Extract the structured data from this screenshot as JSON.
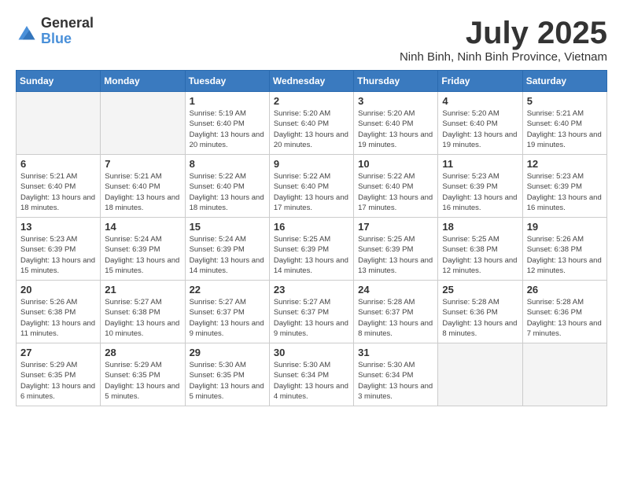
{
  "logo": {
    "general": "General",
    "blue": "Blue"
  },
  "title": "July 2025",
  "location": "Ninh Binh, Ninh Binh Province, Vietnam",
  "days_of_week": [
    "Sunday",
    "Monday",
    "Tuesday",
    "Wednesday",
    "Thursday",
    "Friday",
    "Saturday"
  ],
  "weeks": [
    [
      {
        "day": "",
        "info": ""
      },
      {
        "day": "",
        "info": ""
      },
      {
        "day": "1",
        "info": "Sunrise: 5:19 AM\nSunset: 6:40 PM\nDaylight: 13 hours and 20 minutes."
      },
      {
        "day": "2",
        "info": "Sunrise: 5:20 AM\nSunset: 6:40 PM\nDaylight: 13 hours and 20 minutes."
      },
      {
        "day": "3",
        "info": "Sunrise: 5:20 AM\nSunset: 6:40 PM\nDaylight: 13 hours and 19 minutes."
      },
      {
        "day": "4",
        "info": "Sunrise: 5:20 AM\nSunset: 6:40 PM\nDaylight: 13 hours and 19 minutes."
      },
      {
        "day": "5",
        "info": "Sunrise: 5:21 AM\nSunset: 6:40 PM\nDaylight: 13 hours and 19 minutes."
      }
    ],
    [
      {
        "day": "6",
        "info": "Sunrise: 5:21 AM\nSunset: 6:40 PM\nDaylight: 13 hours and 18 minutes."
      },
      {
        "day": "7",
        "info": "Sunrise: 5:21 AM\nSunset: 6:40 PM\nDaylight: 13 hours and 18 minutes."
      },
      {
        "day": "8",
        "info": "Sunrise: 5:22 AM\nSunset: 6:40 PM\nDaylight: 13 hours and 18 minutes."
      },
      {
        "day": "9",
        "info": "Sunrise: 5:22 AM\nSunset: 6:40 PM\nDaylight: 13 hours and 17 minutes."
      },
      {
        "day": "10",
        "info": "Sunrise: 5:22 AM\nSunset: 6:40 PM\nDaylight: 13 hours and 17 minutes."
      },
      {
        "day": "11",
        "info": "Sunrise: 5:23 AM\nSunset: 6:39 PM\nDaylight: 13 hours and 16 minutes."
      },
      {
        "day": "12",
        "info": "Sunrise: 5:23 AM\nSunset: 6:39 PM\nDaylight: 13 hours and 16 minutes."
      }
    ],
    [
      {
        "day": "13",
        "info": "Sunrise: 5:23 AM\nSunset: 6:39 PM\nDaylight: 13 hours and 15 minutes."
      },
      {
        "day": "14",
        "info": "Sunrise: 5:24 AM\nSunset: 6:39 PM\nDaylight: 13 hours and 15 minutes."
      },
      {
        "day": "15",
        "info": "Sunrise: 5:24 AM\nSunset: 6:39 PM\nDaylight: 13 hours and 14 minutes."
      },
      {
        "day": "16",
        "info": "Sunrise: 5:25 AM\nSunset: 6:39 PM\nDaylight: 13 hours and 14 minutes."
      },
      {
        "day": "17",
        "info": "Sunrise: 5:25 AM\nSunset: 6:39 PM\nDaylight: 13 hours and 13 minutes."
      },
      {
        "day": "18",
        "info": "Sunrise: 5:25 AM\nSunset: 6:38 PM\nDaylight: 13 hours and 12 minutes."
      },
      {
        "day": "19",
        "info": "Sunrise: 5:26 AM\nSunset: 6:38 PM\nDaylight: 13 hours and 12 minutes."
      }
    ],
    [
      {
        "day": "20",
        "info": "Sunrise: 5:26 AM\nSunset: 6:38 PM\nDaylight: 13 hours and 11 minutes."
      },
      {
        "day": "21",
        "info": "Sunrise: 5:27 AM\nSunset: 6:38 PM\nDaylight: 13 hours and 10 minutes."
      },
      {
        "day": "22",
        "info": "Sunrise: 5:27 AM\nSunset: 6:37 PM\nDaylight: 13 hours and 9 minutes."
      },
      {
        "day": "23",
        "info": "Sunrise: 5:27 AM\nSunset: 6:37 PM\nDaylight: 13 hours and 9 minutes."
      },
      {
        "day": "24",
        "info": "Sunrise: 5:28 AM\nSunset: 6:37 PM\nDaylight: 13 hours and 8 minutes."
      },
      {
        "day": "25",
        "info": "Sunrise: 5:28 AM\nSunset: 6:36 PM\nDaylight: 13 hours and 8 minutes."
      },
      {
        "day": "26",
        "info": "Sunrise: 5:28 AM\nSunset: 6:36 PM\nDaylight: 13 hours and 7 minutes."
      }
    ],
    [
      {
        "day": "27",
        "info": "Sunrise: 5:29 AM\nSunset: 6:35 PM\nDaylight: 13 hours and 6 minutes."
      },
      {
        "day": "28",
        "info": "Sunrise: 5:29 AM\nSunset: 6:35 PM\nDaylight: 13 hours and 5 minutes."
      },
      {
        "day": "29",
        "info": "Sunrise: 5:30 AM\nSunset: 6:35 PM\nDaylight: 13 hours and 5 minutes."
      },
      {
        "day": "30",
        "info": "Sunrise: 5:30 AM\nSunset: 6:34 PM\nDaylight: 13 hours and 4 minutes."
      },
      {
        "day": "31",
        "info": "Sunrise: 5:30 AM\nSunset: 6:34 PM\nDaylight: 13 hours and 3 minutes."
      },
      {
        "day": "",
        "info": ""
      },
      {
        "day": "",
        "info": ""
      }
    ]
  ]
}
